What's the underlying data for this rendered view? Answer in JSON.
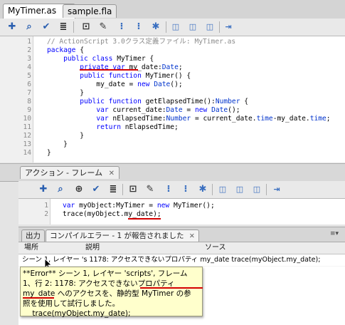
{
  "doc_tabs": [
    {
      "label": "MyTimer.as",
      "close": "✕"
    },
    {
      "label": "sample.fla"
    }
  ],
  "editor": {
    "lines": [
      {
        "n": "1",
        "html": "<span class=\"cm\">// ActionScript 3.0クラス定義ファイル: MyTimer.as</span>"
      },
      {
        "n": "2",
        "html": "<span class=\"kw\">package</span> {"
      },
      {
        "n": "3",
        "html": "    <span class=\"kw\">public class</span> MyTimer {"
      },
      {
        "n": "4",
        "html": "        <span class=\"kw\">private var</span> my_date:<span class=\"st\">Date</span>;"
      },
      {
        "n": "5",
        "html": "        <span class=\"kw\">public function</span> MyTimer() {"
      },
      {
        "n": "6",
        "html": "            my_date = <span class=\"kw\">new</span> <span class=\"st\">Date</span>();"
      },
      {
        "n": "7",
        "html": "        }"
      },
      {
        "n": "8",
        "html": "        <span class=\"kw\">public function</span> getElapsedTime():<span class=\"st\">Number</span> {"
      },
      {
        "n": "9",
        "html": "            <span class=\"kw\">var</span> current_date:<span class=\"st\">Date</span> = <span class=\"kw\">new</span> <span class=\"st\">Date</span>();"
      },
      {
        "n": "10",
        "html": "            <span class=\"kw\">var</span> nElapsedTime:<span class=\"st\">Number</span> = current_date.<span class=\"st\">time</span>-my_date.<span class=\"st\">time</span>;"
      },
      {
        "n": "11",
        "html": "            <span class=\"kw\">return</span> nElapsedTime;"
      },
      {
        "n": "12",
        "html": "        }"
      },
      {
        "n": "13",
        "html": "    }"
      },
      {
        "n": "14",
        "html": "}"
      }
    ]
  },
  "actions_panel": {
    "title": "アクション - フレーム",
    "close": "✕",
    "lines": [
      {
        "n": "1",
        "html": "<span class=\"kw\">var</span> myObject:MyTimer = <span class=\"kw\">new</span> MyTimer();"
      },
      {
        "n": "2",
        "html": "trace(myObject.my_date);"
      }
    ]
  },
  "output_panel": {
    "tabs": [
      {
        "label": "出力"
      },
      {
        "label": "コンパイルエラー - 1 が報告されました",
        "close": "✕"
      }
    ],
    "columns": [
      "場所",
      "説明",
      "ソース"
    ],
    "row": {
      "location": "シーン 1, レイヤー 's 1178: アクセスできないプロパティ my_date trace(myObject.my_date);"
    },
    "tooltip_lines": [
      "**Error** シーン 1, レイヤー 'scripts', フレーム",
      "1、行 2: 1178: アクセスできないプロパティ",
      "my_date へのアクセスを、静的型 MyTimer の参",
      "照を使用して試行しました。",
      "    trace(myObject.my_date);"
    ]
  },
  "colors": {
    "error_underline": "#d40000",
    "keyword": "#0000ff",
    "tooltip_bg": "#ffffcc"
  }
}
